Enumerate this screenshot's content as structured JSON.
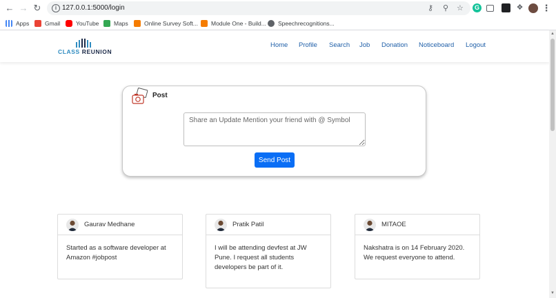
{
  "browser": {
    "url": "127.0.0.1:5000/login",
    "bookmarks": [
      {
        "label": "Apps",
        "color": "#4285f4"
      },
      {
        "label": "Gmail",
        "color": "#ea4335"
      },
      {
        "label": "YouTube",
        "color": "#ff0000"
      },
      {
        "label": "Maps",
        "color": "#34a853"
      },
      {
        "label": "Online Survey Soft...",
        "color": "#f57c00"
      },
      {
        "label": "Module One - Build...",
        "color": "#f57c00"
      },
      {
        "label": "Speechrecognitions...",
        "color": "#5f6368"
      }
    ]
  },
  "header": {
    "logo_part1": "CLASS",
    "logo_part2": "REUNION",
    "nav": [
      "Home",
      "Profile",
      "Search",
      "Job",
      "Donation",
      "Noticeboard",
      "Logout"
    ]
  },
  "composer": {
    "title": "Post",
    "placeholder": "Share an Update Mention your friend with @ Symbol",
    "submit_label": "Send Post"
  },
  "feed": [
    {
      "name": "Gaurav Medhane",
      "text": "Started as a software developer at Amazon #jobpost"
    },
    {
      "name": "Pratik Patil",
      "text": "I will be attending devfest at JW Pune. I request all students developers be part of it."
    },
    {
      "name": "MITAOE",
      "text": "Nakshatra is on 14 February 2020. We request everyone to attend."
    }
  ],
  "colors": {
    "accent": "#0a6ef5",
    "nav_link": "#1f5fa8",
    "logo_primary": "#2e8bc0",
    "logo_secondary": "#1c2a48"
  }
}
